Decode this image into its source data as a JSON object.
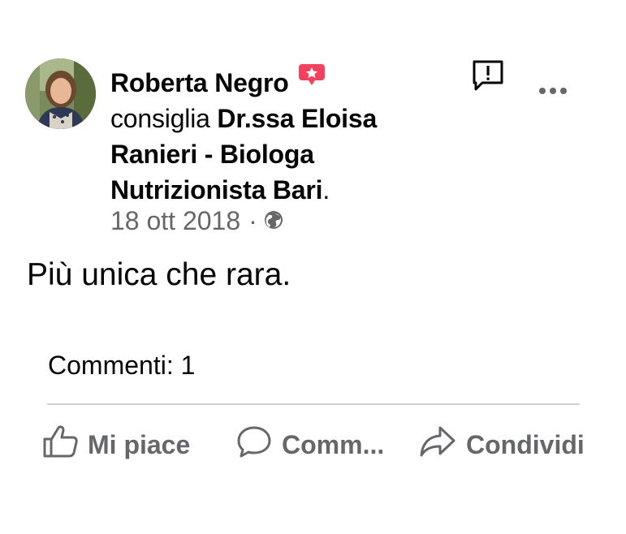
{
  "post": {
    "author": "Roberta Negro",
    "verb": "consiglia",
    "page_name": "Dr.ssa Eloisa Ranieri - Biologa Nutrizionista Bari",
    "page_suffix": ".",
    "date": "18 ott 2018",
    "separator": "·",
    "privacy_icon": "globe-icon",
    "body": "Più unica che rara.",
    "comments_label": "Commenti: 1"
  },
  "header_actions": {
    "report_icon": "report-icon",
    "more_icon": "more-dots-icon"
  },
  "actions": {
    "like_label": "Mi piace",
    "comment_label": "Comm...",
    "share_label": "Condividi"
  },
  "colors": {
    "text_primary": "#050505",
    "text_secondary": "#65676b",
    "badge_pink": "#f3425f",
    "divider": "#ced0d4"
  }
}
